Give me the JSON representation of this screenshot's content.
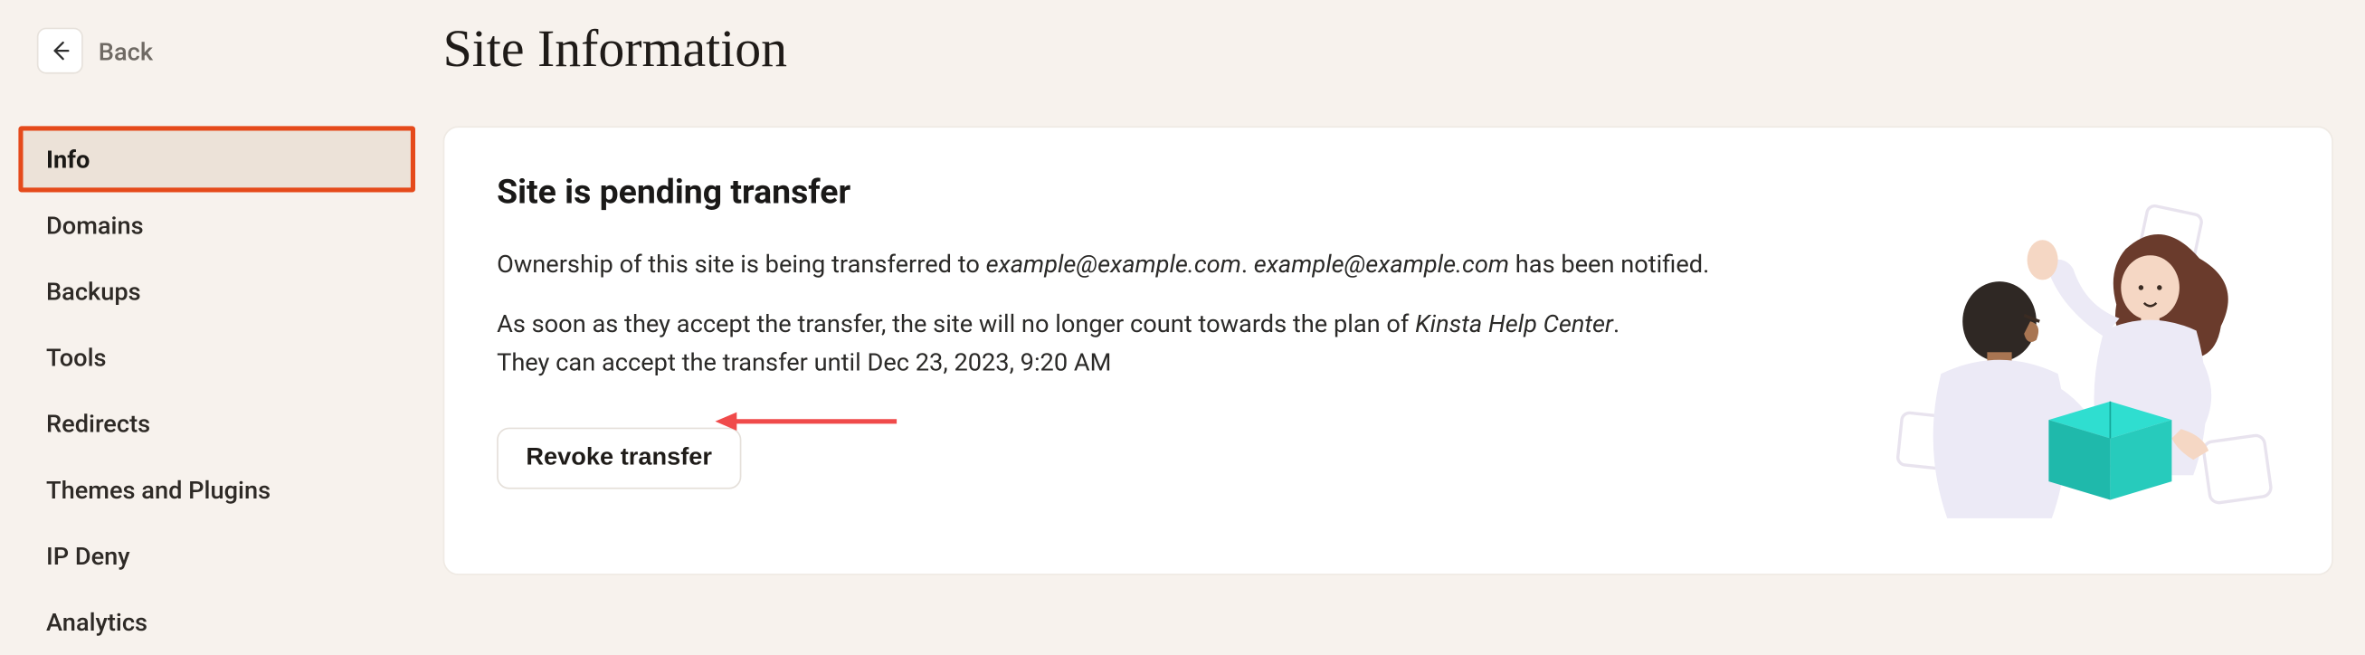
{
  "back": {
    "label": "Back"
  },
  "sidebar": {
    "items": [
      {
        "label": "Info",
        "active": true
      },
      {
        "label": "Domains"
      },
      {
        "label": "Backups"
      },
      {
        "label": "Tools"
      },
      {
        "label": "Redirects"
      },
      {
        "label": "Themes and Plugins"
      },
      {
        "label": "IP Deny"
      },
      {
        "label": "Analytics"
      }
    ]
  },
  "page": {
    "title": "Site Information"
  },
  "transfer": {
    "heading": "Site is pending transfer",
    "p1_prefix": "Ownership of this site is being transferred to ",
    "p1_email1": "example@example.com",
    "p1_mid": ". ",
    "p1_email2": "example@example.com",
    "p1_suffix": " has been notified.",
    "p2_prefix": "As soon as they accept the transfer, the site will no longer count towards the plan of ",
    "p2_plan": "Kinsta Help Center",
    "p2_suffix": ".",
    "p3_prefix": "They can accept the transfer until ",
    "p3_deadline": "Dec 23, 2023, 9:20 AM",
    "revoke_label": "Revoke transfer"
  },
  "annotation": {
    "highlight_color": "#e54a1b",
    "arrow_color": "#f04a4a"
  }
}
